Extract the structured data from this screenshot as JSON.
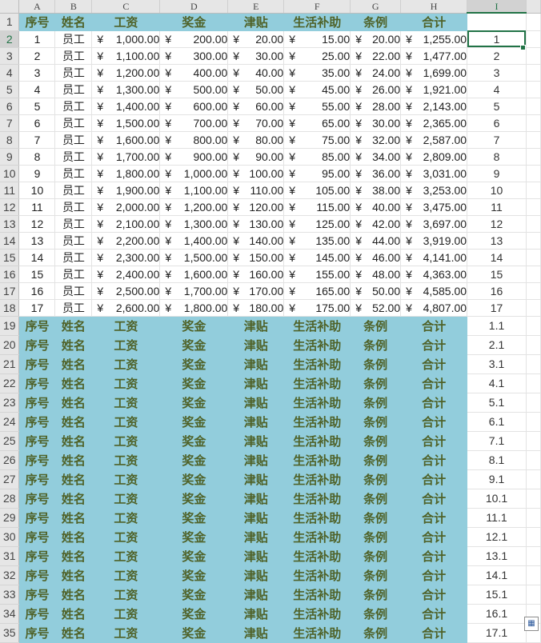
{
  "columns": [
    "A",
    "B",
    "C",
    "D",
    "E",
    "F",
    "G",
    "H",
    "I"
  ],
  "selected_column": "I",
  "selected_row": "2",
  "headers": [
    "序号",
    "姓名",
    "工资",
    "奖金",
    "津贴",
    "生活补助",
    "条例",
    "合计"
  ],
  "currency": "¥",
  "data_rows": [
    {
      "row": "2",
      "no": "1",
      "name": "员工",
      "salary": "1,000.00",
      "bonus": "200.00",
      "allowance": "20.00",
      "subsidy": "15.00",
      "rule": "20.00",
      "total": "1,255.00",
      "i": "1"
    },
    {
      "row": "3",
      "no": "2",
      "name": "员工",
      "salary": "1,100.00",
      "bonus": "300.00",
      "allowance": "30.00",
      "subsidy": "25.00",
      "rule": "22.00",
      "total": "1,477.00",
      "i": "2"
    },
    {
      "row": "4",
      "no": "3",
      "name": "员工",
      "salary": "1,200.00",
      "bonus": "400.00",
      "allowance": "40.00",
      "subsidy": "35.00",
      "rule": "24.00",
      "total": "1,699.00",
      "i": "3"
    },
    {
      "row": "5",
      "no": "4",
      "name": "员工",
      "salary": "1,300.00",
      "bonus": "500.00",
      "allowance": "50.00",
      "subsidy": "45.00",
      "rule": "26.00",
      "total": "1,921.00",
      "i": "4"
    },
    {
      "row": "6",
      "no": "5",
      "name": "员工",
      "salary": "1,400.00",
      "bonus": "600.00",
      "allowance": "60.00",
      "subsidy": "55.00",
      "rule": "28.00",
      "total": "2,143.00",
      "i": "5"
    },
    {
      "row": "7",
      "no": "6",
      "name": "员工",
      "salary": "1,500.00",
      "bonus": "700.00",
      "allowance": "70.00",
      "subsidy": "65.00",
      "rule": "30.00",
      "total": "2,365.00",
      "i": "6"
    },
    {
      "row": "8",
      "no": "7",
      "name": "员工",
      "salary": "1,600.00",
      "bonus": "800.00",
      "allowance": "80.00",
      "subsidy": "75.00",
      "rule": "32.00",
      "total": "2,587.00",
      "i": "7"
    },
    {
      "row": "9",
      "no": "8",
      "name": "员工",
      "salary": "1,700.00",
      "bonus": "900.00",
      "allowance": "90.00",
      "subsidy": "85.00",
      "rule": "34.00",
      "total": "2,809.00",
      "i": "8"
    },
    {
      "row": "10",
      "no": "9",
      "name": "员工",
      "salary": "1,800.00",
      "bonus": "1,000.00",
      "allowance": "100.00",
      "subsidy": "95.00",
      "rule": "36.00",
      "total": "3,031.00",
      "i": "9"
    },
    {
      "row": "11",
      "no": "10",
      "name": "员工",
      "salary": "1,900.00",
      "bonus": "1,100.00",
      "allowance": "110.00",
      "subsidy": "105.00",
      "rule": "38.00",
      "total": "3,253.00",
      "i": "10"
    },
    {
      "row": "12",
      "no": "11",
      "name": "员工",
      "salary": "2,000.00",
      "bonus": "1,200.00",
      "allowance": "120.00",
      "subsidy": "115.00",
      "rule": "40.00",
      "total": "3,475.00",
      "i": "11"
    },
    {
      "row": "13",
      "no": "12",
      "name": "员工",
      "salary": "2,100.00",
      "bonus": "1,300.00",
      "allowance": "130.00",
      "subsidy": "125.00",
      "rule": "42.00",
      "total": "3,697.00",
      "i": "12"
    },
    {
      "row": "14",
      "no": "13",
      "name": "员工",
      "salary": "2,200.00",
      "bonus": "1,400.00",
      "allowance": "140.00",
      "subsidy": "135.00",
      "rule": "44.00",
      "total": "3,919.00",
      "i": "13"
    },
    {
      "row": "15",
      "no": "14",
      "name": "员工",
      "salary": "2,300.00",
      "bonus": "1,500.00",
      "allowance": "150.00",
      "subsidy": "145.00",
      "rule": "46.00",
      "total": "4,141.00",
      "i": "14"
    },
    {
      "row": "16",
      "no": "15",
      "name": "员工",
      "salary": "2,400.00",
      "bonus": "1,600.00",
      "allowance": "160.00",
      "subsidy": "155.00",
      "rule": "48.00",
      "total": "4,363.00",
      "i": "15"
    },
    {
      "row": "17",
      "no": "16",
      "name": "员工",
      "salary": "2,500.00",
      "bonus": "1,700.00",
      "allowance": "170.00",
      "subsidy": "165.00",
      "rule": "50.00",
      "total": "4,585.00",
      "i": "16"
    },
    {
      "row": "18",
      "no": "17",
      "name": "员工",
      "salary": "2,600.00",
      "bonus": "1,800.00",
      "allowance": "180.00",
      "subsidy": "175.00",
      "rule": "52.00",
      "total": "4,807.00",
      "i": "17"
    }
  ],
  "repeat_header_rows": [
    {
      "row": "19",
      "i": "1.1"
    },
    {
      "row": "20",
      "i": "2.1"
    },
    {
      "row": "21",
      "i": "3.1"
    },
    {
      "row": "22",
      "i": "4.1"
    },
    {
      "row": "23",
      "i": "5.1"
    },
    {
      "row": "24",
      "i": "6.1"
    },
    {
      "row": "25",
      "i": "7.1"
    },
    {
      "row": "26",
      "i": "8.1"
    },
    {
      "row": "27",
      "i": "9.1"
    },
    {
      "row": "28",
      "i": "10.1"
    },
    {
      "row": "29",
      "i": "11.1"
    },
    {
      "row": "30",
      "i": "12.1"
    },
    {
      "row": "31",
      "i": "13.1"
    },
    {
      "row": "32",
      "i": "14.1"
    },
    {
      "row": "33",
      "i": "15.1"
    },
    {
      "row": "34",
      "i": "16.1"
    },
    {
      "row": "35",
      "i": "17.1"
    }
  ],
  "colors": {
    "header_fill": "#92cddc",
    "header_text": "#4f6228",
    "selection": "#217346"
  },
  "icons": {
    "autofill_options": "paste-options-icon"
  }
}
